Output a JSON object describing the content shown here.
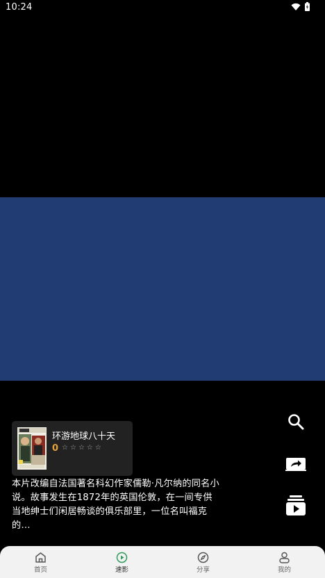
{
  "status_bar": {
    "time": "10:24"
  },
  "movie": {
    "title": "环游地球八十天",
    "rating": "0",
    "stars": [
      "☆",
      "☆",
      "☆",
      "☆",
      "☆"
    ],
    "description": "本片改编自法国著名科幻作家儒勒·凡尔纳的同名小说。故事发生在1872年的英国伦敦，在一间专供当地绅士们闲居畅谈的俱乐部里，一位名叫福克的…"
  },
  "side_actions": {
    "search_icon": "search-icon",
    "share_icon": "share-icon",
    "playlist_icon": "playlist-icon"
  },
  "bottom_nav": {
    "items": [
      {
        "label": "首页",
        "icon": "home-icon"
      },
      {
        "label": "速影",
        "icon": "play-circle-icon"
      },
      {
        "label": "分享",
        "icon": "compass-icon"
      },
      {
        "label": "我的",
        "icon": "user-icon"
      }
    ]
  },
  "colors": {
    "video_background": "#213c73",
    "card_background": "#222222",
    "rating": "#e2a33a",
    "nav_background": "#f2f2f2",
    "nav_active": "#2e9b5a"
  }
}
